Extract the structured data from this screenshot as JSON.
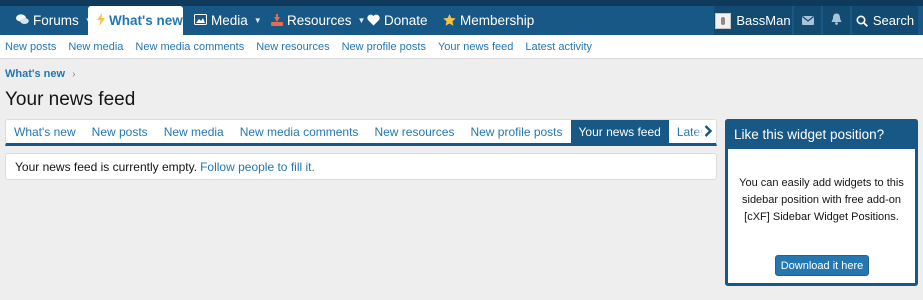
{
  "top_nav": {
    "tabs": [
      {
        "label": "Forums",
        "icon": "comments-icon",
        "has_caret": true
      },
      {
        "label": "What's new",
        "icon": "bolt-icon",
        "active": true
      },
      {
        "label": "Media",
        "icon": "image-icon",
        "has_caret": true
      },
      {
        "label": "Resources",
        "icon": "download-icon",
        "has_caret": true
      },
      {
        "label": "Donate",
        "icon": "heart-icon"
      },
      {
        "label": "Membership",
        "icon": "star-icon"
      }
    ],
    "user": {
      "name": "BassMan"
    },
    "search_label": "Search"
  },
  "sub_nav": {
    "links": [
      "New posts",
      "New media",
      "New media comments",
      "New resources",
      "New profile posts",
      "Your news feed",
      "Latest activity"
    ]
  },
  "breadcrumb": {
    "label": "What's new"
  },
  "page_title": "Your news feed",
  "tabs": {
    "items": [
      "What's new",
      "New posts",
      "New media",
      "New media comments",
      "New resources",
      "New profile posts",
      "Your news feed",
      "Latest activity"
    ],
    "active_index": 6
  },
  "empty_message": {
    "text": "Your news feed is currently empty.",
    "link": "Follow people to fill it."
  },
  "widget": {
    "title": "Like this widget position?",
    "body": "You can easily add widgets to this sidebar position with free add-on [cXF] Sidebar Widget Positions.",
    "button": "Download it here"
  },
  "colors": {
    "nav_background": "#185886",
    "link": "#2577b1",
    "page_background": "#eeeeee"
  }
}
